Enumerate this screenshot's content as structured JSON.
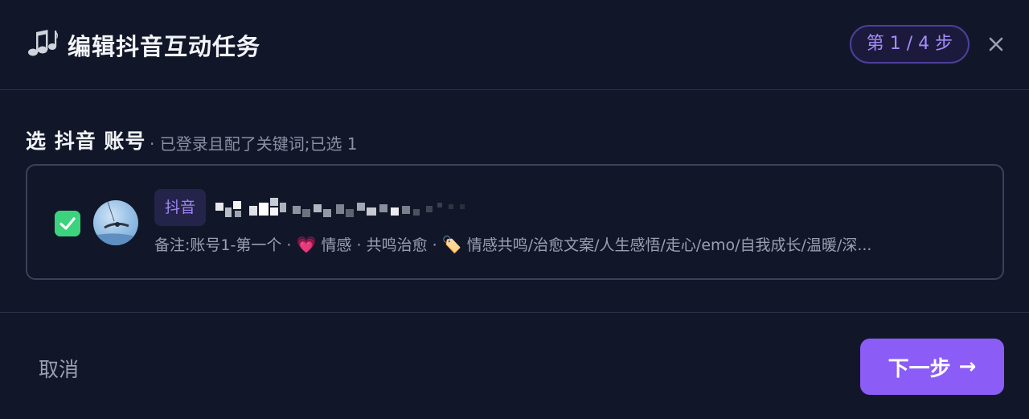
{
  "header": {
    "title": "编辑抖音互动任务",
    "step": "第 1 / 4 步"
  },
  "section": {
    "label": "选 抖音 账号",
    "hint": "· 已登录且配了关键词;已选 1"
  },
  "account": {
    "checked": true,
    "platform": "抖音",
    "name": "",
    "remark": "备注:账号1-第一个",
    "sep": "·",
    "emotion_emoji": "💗",
    "emotion": "情感",
    "category": "共鸣治愈",
    "tag_emoji": "🏷️",
    "keywords": "情感共鸣/治愈文案/人生感悟/走心/emo/自我成长/温暖/深..."
  },
  "footer": {
    "cancel_label": "取消",
    "next_label": "下一步",
    "next_arrow": "→"
  },
  "colors": {
    "background": "#111729",
    "accent": "#8b5cf6",
    "checkbox": "#3bd37e",
    "border": "#3a4258"
  }
}
